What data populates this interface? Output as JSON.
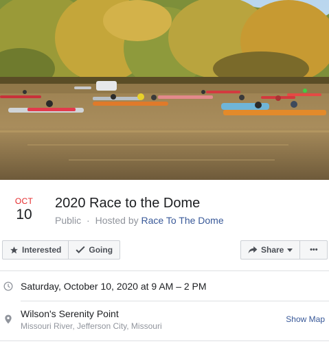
{
  "cover": {
    "image_name": "event-cover-photo-kayaks-on-river"
  },
  "event": {
    "month": "OCT",
    "day": "10",
    "title": "2020 Race to the Dome",
    "privacy": "Public",
    "separator": "·",
    "hosted_by_prefix": "Hosted by",
    "host_name": "Race To The Dome"
  },
  "actions": {
    "interested_label": "Interested",
    "interested_icon": "star-icon",
    "going_label": "Going",
    "going_icon": "checkmark-icon",
    "share_label": "Share",
    "share_icon": "share-arrow-icon",
    "more_label": "•••"
  },
  "details": {
    "time_icon": "clock-icon",
    "datetime": "Saturday, October 10, 2020 at 9 AM – 2 PM",
    "location_icon": "map-pin-icon",
    "place_name": "Wilson's Serenity Point",
    "place_address": "Missouri River, Jefferson City, Missouri",
    "show_map_label": "Show Map"
  },
  "colors": {
    "month_red": "#e4282a",
    "link_blue": "#385898",
    "muted_gray": "#90949c",
    "button_bg": "#f5f6f7",
    "border_gray": "#ccd0d5"
  }
}
